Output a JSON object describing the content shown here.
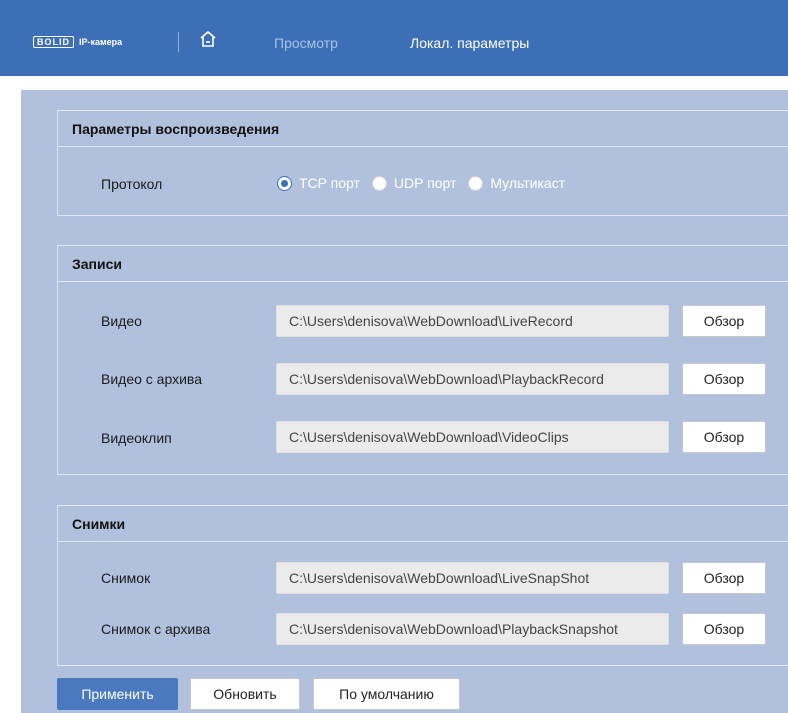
{
  "header": {
    "logo_box": "BOLID",
    "logo_text": "IP-камера",
    "nav_view": "Просмотр",
    "nav_local": "Локал. параметры",
    "home_icon": "home-icon"
  },
  "playback": {
    "title": "Параметры воспроизведения",
    "protocol_label": "Протокол",
    "options": [
      "TCP порт",
      "UDP порт",
      "Мультикаст"
    ],
    "selected": "TCP порт"
  },
  "records": {
    "title": "Записи",
    "rows": [
      {
        "label": "Видео",
        "path": "C:\\Users\\denisova\\WebDownload\\LiveRecord",
        "button": "Обзор"
      },
      {
        "label": "Видео с архива",
        "path": "C:\\Users\\denisova\\WebDownload\\PlaybackRecord",
        "button": "Обзор"
      },
      {
        "label": "Видеоклип",
        "path": "C:\\Users\\denisova\\WebDownload\\VideoClips",
        "button": "Обзор"
      }
    ]
  },
  "snapshots": {
    "title": "Снимки",
    "rows": [
      {
        "label": "Снимок",
        "path": "C:\\Users\\denisova\\WebDownload\\LiveSnapShot",
        "button": "Обзор"
      },
      {
        "label": "Снимок с архива",
        "path": "C:\\Users\\denisova\\WebDownload\\PlaybackSnapshot",
        "button": "Обзор"
      }
    ]
  },
  "actions": {
    "apply": "Применить",
    "refresh": "Обновить",
    "default": "По умолчанию"
  },
  "colors": {
    "topbar": "#3d6fb6",
    "content_bg": "#b1c1dd",
    "primary_button": "#4a79c0"
  }
}
